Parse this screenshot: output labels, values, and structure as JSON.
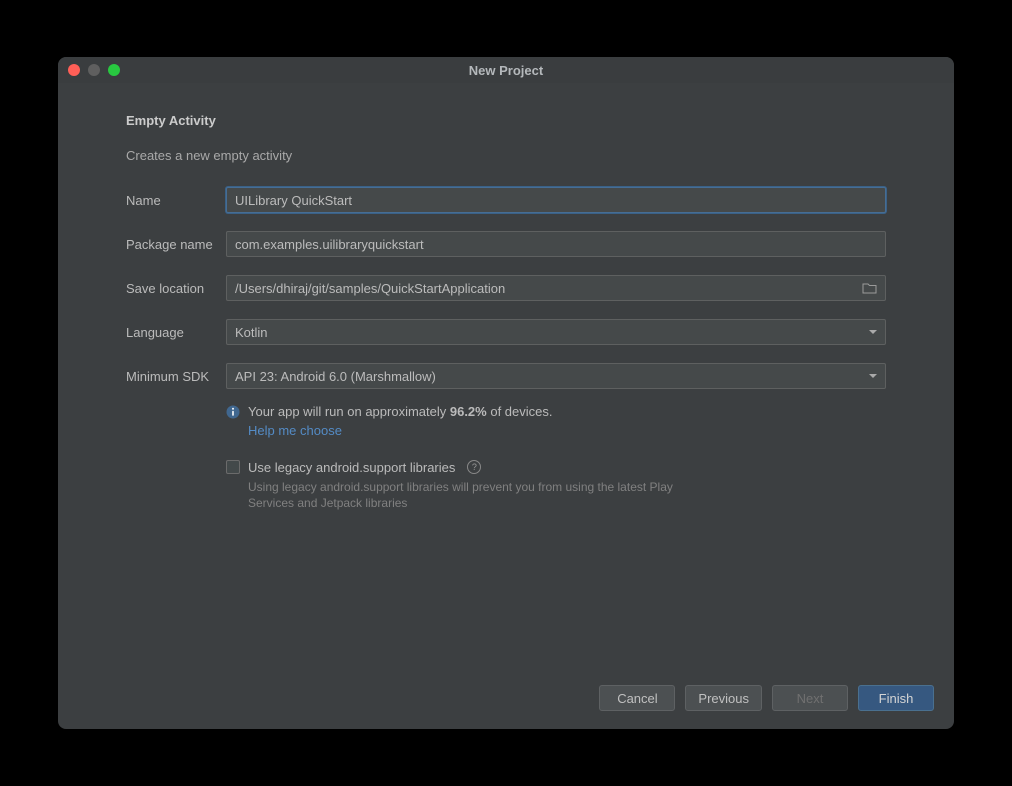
{
  "window": {
    "title": "New Project"
  },
  "page": {
    "heading": "Empty Activity",
    "subheading": "Creates a new empty activity"
  },
  "form": {
    "name": {
      "label": "Name",
      "value": "UILibrary QuickStart"
    },
    "package": {
      "label": "Package name",
      "value": "com.examples.uilibraryquickstart"
    },
    "save_location": {
      "label": "Save location",
      "value": "/Users/dhiraj/git/samples/QuickStartApplication"
    },
    "language": {
      "label": "Language",
      "value": "Kotlin"
    },
    "min_sdk": {
      "label": "Minimum SDK",
      "value": "API 23: Android 6.0 (Marshmallow)"
    }
  },
  "info": {
    "prefix": "Your app will run on approximately ",
    "percent": "96.2%",
    "suffix": " of devices.",
    "help_link": "Help me choose"
  },
  "legacy": {
    "label": "Use legacy android.support libraries",
    "desc": "Using legacy android.support libraries will prevent you from using the latest Play Services and Jetpack libraries"
  },
  "buttons": {
    "cancel": "Cancel",
    "previous": "Previous",
    "next": "Next",
    "finish": "Finish"
  }
}
